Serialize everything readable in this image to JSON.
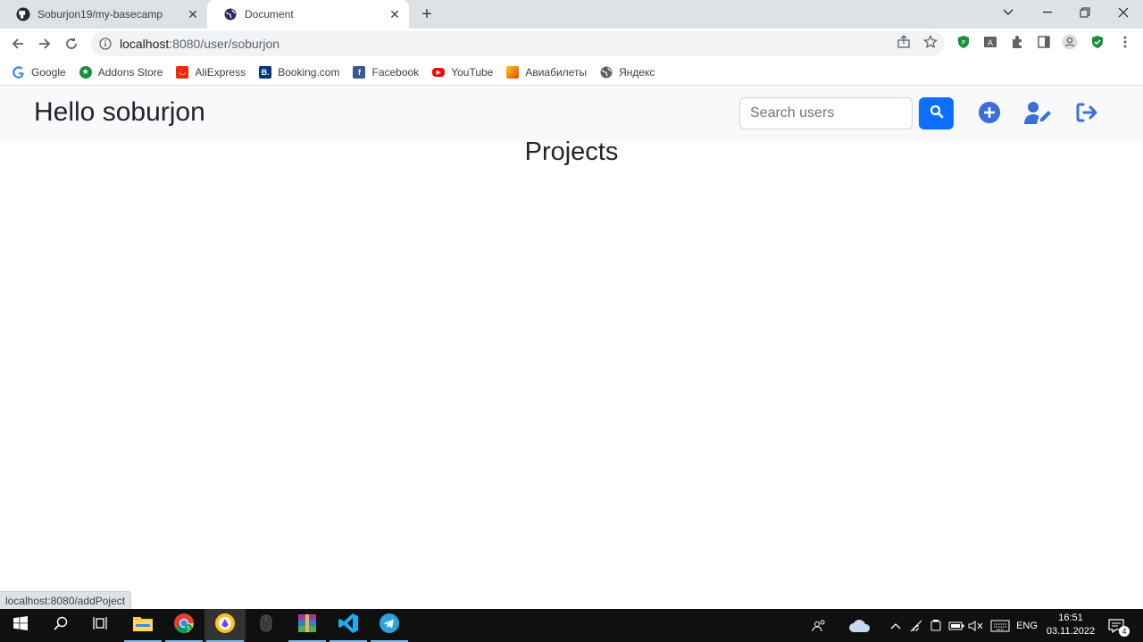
{
  "browser": {
    "tabs": [
      {
        "title": "Soburjon19/my-basecamp",
        "icon": "github-icon"
      },
      {
        "title": "Document",
        "icon": "globe-icon"
      }
    ],
    "address": {
      "host": "localhost",
      "path": ":8080/user/soburjon"
    },
    "bookmarks": [
      {
        "label": "Google",
        "icon": "google-icon",
        "color": "#4285f4"
      },
      {
        "label": "Addons Store",
        "icon": "addons-store-icon",
        "color": "#1e8e3e"
      },
      {
        "label": "AliExpress",
        "icon": "aliexpress-icon",
        "color": "#e62e04"
      },
      {
        "label": "Booking.com",
        "icon": "booking-icon",
        "color": "#003580"
      },
      {
        "label": "Facebook",
        "icon": "facebook-icon",
        "color": "#1877f2"
      },
      {
        "label": "YouTube",
        "icon": "youtube-icon",
        "color": "#ff0000"
      },
      {
        "label": "Авиабилеты",
        "icon": "aviabilety-icon",
        "color": "#e8430c"
      },
      {
        "label": "Яндекс",
        "icon": "globe-icon",
        "color": "#5f6368"
      }
    ],
    "status_url": "localhost:8080/addPoject"
  },
  "page": {
    "brand": "Hello soburjon",
    "search_placeholder": "Search users",
    "heading": "Projects",
    "accent_color": "#0d6efd",
    "icon_color": "#3b6fd8"
  },
  "taskbar": {
    "time": "16:51",
    "date": "03.11.2022",
    "language": "ENG",
    "notifications": "4"
  }
}
